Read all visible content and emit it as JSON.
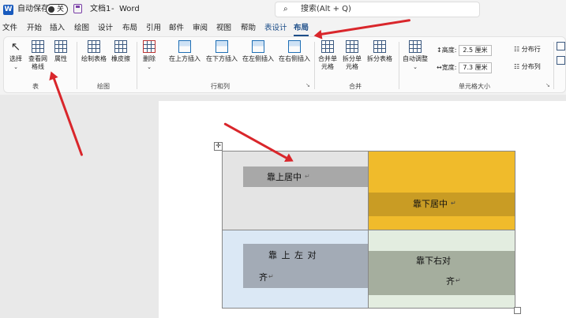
{
  "titlebar": {
    "autosave_label": "自动保存",
    "toggle_state": "关",
    "doc_title": "文档1",
    "separator": "-",
    "app_name": "Word",
    "search_placeholder": "搜索(Alt + Q)"
  },
  "menu_tabs": [
    "文件",
    "开始",
    "插入",
    "绘图",
    "设计",
    "布局",
    "引用",
    "邮件",
    "审阅",
    "视图",
    "帮助",
    "表设计",
    "布局"
  ],
  "ribbon": {
    "table_group": {
      "label": "表",
      "buttons": [
        "选择",
        "查看网格线",
        "属性"
      ]
    },
    "draw_group": {
      "label": "绘图",
      "buttons": [
        "绘制表格",
        "橡皮擦"
      ]
    },
    "rows_cols_group": {
      "label": "行和列",
      "buttons": [
        "删除",
        "在上方插入",
        "在下方插入",
        "在左侧插入",
        "在右侧插入"
      ]
    },
    "merge_group": {
      "label": "合并",
      "buttons": [
        "合并单元格",
        "拆分单元格",
        "拆分表格"
      ]
    },
    "cell_size_group": {
      "label": "单元格大小",
      "autofit": "自动调整",
      "height_label": "高度:",
      "height_value": "2.5 厘米",
      "width_label": "宽度:",
      "width_value": "7.3 厘米",
      "distribute_rows": "分布行",
      "distribute_cols": "分布列"
    }
  },
  "table": {
    "cell1": "靠上居中",
    "cell2": "靠下居中",
    "cell3_line1": "靠 上 左 对",
    "cell3_line2": "齐",
    "cell4_line1": "靠下右对",
    "cell4_line2": "齐",
    "para_mark": "↵"
  },
  "colors": {
    "accent": "#1d4e89",
    "annotation_arrow": "#d9262b",
    "cell_yellow": "#f0bb2b",
    "cell_gray": "#a9a9a9",
    "cell_blue": "#dbe8f5",
    "cell_green": "#e3ede0"
  }
}
